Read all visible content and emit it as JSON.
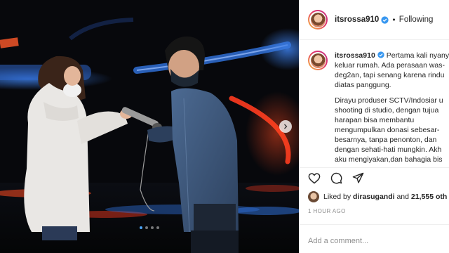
{
  "post": {
    "username": "itsrossa910",
    "follow_state": "Following",
    "separator": "•",
    "caption_lines": [
      "Pertama kali nyany",
      "keluar rumah. Ada perasaan was-",
      "deg2an, tapi senang karena rindu",
      "diatas panggung.",
      "",
      "Dirayu produser SCTV/Indosiar u",
      "shooting di studio, dengan tujua",
      "harapan bisa membantu",
      "mengumpulkan donasi sebesar-",
      "besarnya, tanpa penonton, dan",
      "dengan sehati-hati mungkin. Akh",
      "aku mengiyakan,dan bahagia bis"
    ],
    "likes_prefix": "Liked by",
    "likes_user": "dirasugandi",
    "likes_and": "and",
    "likes_count": "21,555 oth",
    "timestamp": "1 HOUR AGO",
    "comment_placeholder": "Add a comment..."
  },
  "carousel": {
    "dot_count": 4,
    "active_index": 0
  },
  "colors": {
    "verified": "#3897f0",
    "stage_red": "#ff3b1f",
    "stage_blue": "#2f6fd6"
  },
  "icons": {
    "verified": "verified-badge-icon",
    "like": "heart-icon",
    "comment": "comment-bubble-icon",
    "share": "paper-plane-icon",
    "next": "chevron-right-icon"
  }
}
